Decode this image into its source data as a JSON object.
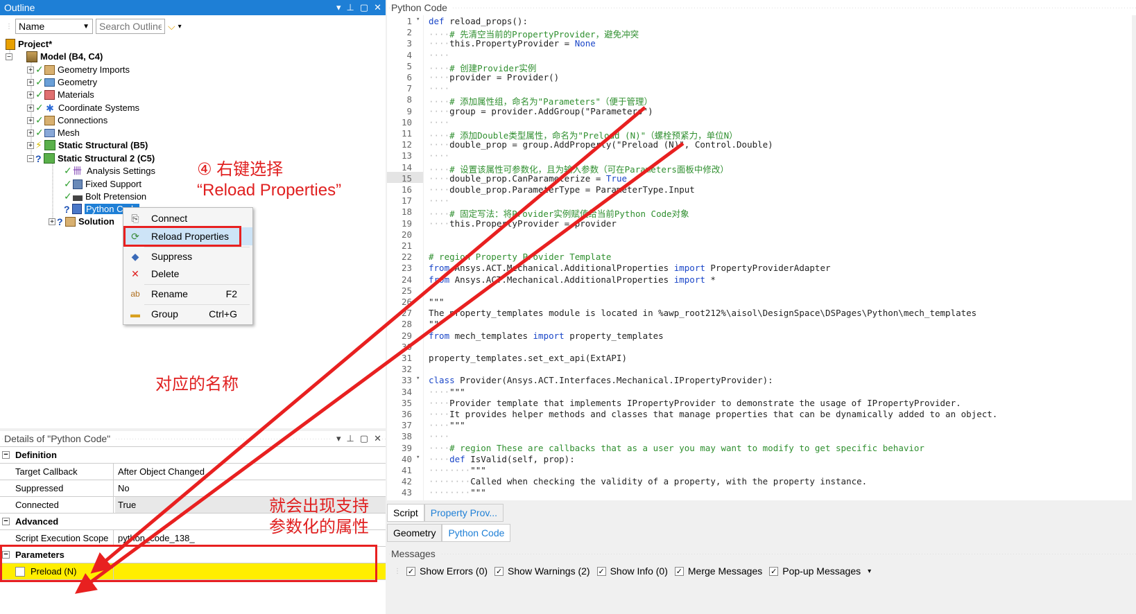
{
  "outline": {
    "title": "Outline",
    "name_combo": "Name",
    "search_placeholder": "Search Outline",
    "controls": {
      "pin": "▾ ⊥ ▢ ✕"
    },
    "tree": [
      {
        "label": "Project*",
        "bold": true
      },
      {
        "label": "Model (B4, C4)",
        "bold": true
      },
      {
        "label": "Geometry Imports"
      },
      {
        "label": "Geometry"
      },
      {
        "label": "Materials"
      },
      {
        "label": "Coordinate Systems"
      },
      {
        "label": "Connections"
      },
      {
        "label": "Mesh"
      },
      {
        "label": "Static Structural (B5)",
        "bold": true
      },
      {
        "label": "Static Structural 2 (C5)",
        "bold": true
      },
      {
        "label": "Analysis Settings"
      },
      {
        "label": "Fixed Support"
      },
      {
        "label": "Bolt Pretension"
      },
      {
        "label": "Python Code",
        "selected": true
      },
      {
        "label": "Solution",
        "bold": true
      }
    ]
  },
  "context_menu": {
    "items": [
      {
        "label": "Connect",
        "shortcut": ""
      },
      {
        "label": "Reload Properties",
        "shortcut": ""
      },
      {
        "label": "Suppress",
        "shortcut": ""
      },
      {
        "label": "Delete",
        "shortcut": ""
      },
      {
        "label": "Rename",
        "shortcut": "F2"
      },
      {
        "label": "Group",
        "shortcut": "Ctrl+G"
      }
    ]
  },
  "annotations": {
    "step4_line1": "④ 右键选择",
    "step4_line2": "“Reload Properties”",
    "names": "对应的名称",
    "params_line1": "就会出现支持",
    "params_line2": "参数化的属性"
  },
  "details": {
    "title": "Details of \"Python Code\"",
    "rows": [
      {
        "type": "cat",
        "label": "Definition"
      },
      {
        "type": "prop",
        "label": "Target Callback",
        "value": "After Object Changed"
      },
      {
        "type": "prop",
        "label": "Suppressed",
        "value": "No"
      },
      {
        "type": "prop",
        "label": "Connected",
        "value": "True"
      },
      {
        "type": "cat",
        "label": "Advanced"
      },
      {
        "type": "prop",
        "label": "Script Execution Scope",
        "value": "python_code_138_"
      },
      {
        "type": "cat",
        "label": "Parameters"
      },
      {
        "type": "param",
        "label": "Preload (N)",
        "value": ""
      }
    ]
  },
  "code_panel": {
    "title": "Python Code",
    "lines": [
      {
        "n": "1",
        "t": "def reload_props():"
      },
      {
        "n": "2",
        "t": "    # 先清空当前的PropertyProvider，避免冲突"
      },
      {
        "n": "3",
        "t": "    this.PropertyProvider = None"
      },
      {
        "n": "4",
        "t": "    "
      },
      {
        "n": "5",
        "t": "    # 创建Provider实例"
      },
      {
        "n": "6",
        "t": "    provider = Provider()"
      },
      {
        "n": "7",
        "t": "    "
      },
      {
        "n": "8",
        "t": "    # 添加属性组，命名为\"Parameters\"（便于管理）"
      },
      {
        "n": "9",
        "t": "    group = provider.AddGroup(\"Parameters\")"
      },
      {
        "n": "10",
        "t": "    "
      },
      {
        "n": "11",
        "t": "    # 添加Double类型属性，命名为\"Preload (N)\"（螺栓预紧力，单位N）"
      },
      {
        "n": "12",
        "t": "    double_prop = group.AddProperty(\"Preload (N)\", Control.Double)"
      },
      {
        "n": "13",
        "t": "    "
      },
      {
        "n": "14",
        "t": "    # 设置该属性可参数化，且为输入参数（可在Parameters面板中修改）"
      },
      {
        "n": "15",
        "t": "    double_prop.CanParameterize = True"
      },
      {
        "n": "16",
        "t": "    double_prop.ParameterType = ParameterType.Input"
      },
      {
        "n": "17",
        "t": "    "
      },
      {
        "n": "18",
        "t": "    # 固定写法：将Provider实例赋值给当前Python Code对象"
      },
      {
        "n": "19",
        "t": "    this.PropertyProvider = provider"
      },
      {
        "n": "20",
        "t": ""
      },
      {
        "n": "21",
        "t": ""
      },
      {
        "n": "22",
        "t": "# region Property Provider Template"
      },
      {
        "n": "23",
        "t": "from Ansys.ACT.Mechanical.AdditionalProperties import PropertyProviderAdapter"
      },
      {
        "n": "24",
        "t": "from Ansys.ACT.Mechanical.AdditionalProperties import *"
      },
      {
        "n": "25",
        "t": ""
      },
      {
        "n": "26",
        "t": "\"\"\""
      },
      {
        "n": "27",
        "t": "The property_templates module is located in %awp_root212%\\aisol\\DesignSpace\\DSPages\\Python\\mech_templates"
      },
      {
        "n": "28",
        "t": "\"\"\""
      },
      {
        "n": "29",
        "t": "from mech_templates import property_templates"
      },
      {
        "n": "30",
        "t": ""
      },
      {
        "n": "31",
        "t": "property_templates.set_ext_api(ExtAPI)"
      },
      {
        "n": "32",
        "t": ""
      },
      {
        "n": "33",
        "t": "class Provider(Ansys.ACT.Interfaces.Mechanical.IPropertyProvider):"
      },
      {
        "n": "34",
        "t": "    \"\"\""
      },
      {
        "n": "35",
        "t": "    Provider template that implements IPropertyProvider to demonstrate the usage of IPropertyProvider."
      },
      {
        "n": "36",
        "t": "    It provides helper methods and classes that manage properties that can be dynamically added to an object."
      },
      {
        "n": "37",
        "t": "    \"\"\""
      },
      {
        "n": "38",
        "t": "    "
      },
      {
        "n": "39",
        "t": "    # region These are callbacks that as a user you may want to modify to get specific behavior"
      },
      {
        "n": "40",
        "t": "    def IsValid(self, prop):"
      },
      {
        "n": "41",
        "t": "        \"\"\""
      },
      {
        "n": "42",
        "t": "        Called when checking the validity of a property, with the property instance."
      },
      {
        "n": "43",
        "t": "        \"\"\""
      }
    ],
    "tabs_row1": [
      "Script",
      "Property Prov..."
    ],
    "tabs_row2": [
      "Geometry",
      "Python Code"
    ]
  },
  "messages": {
    "title": "Messages",
    "options": [
      {
        "label": "Show Errors",
        "count": "(0)"
      },
      {
        "label": "Show Warnings",
        "count": "(2)"
      },
      {
        "label": "Show Info",
        "count": "(0)"
      },
      {
        "label": "Merge Messages",
        "count": ""
      },
      {
        "label": "Pop-up Messages",
        "count": ""
      }
    ]
  },
  "colors": {
    "accent": "#1e7fd6",
    "annotation": "#e82020",
    "highlight": "#ffee00"
  }
}
